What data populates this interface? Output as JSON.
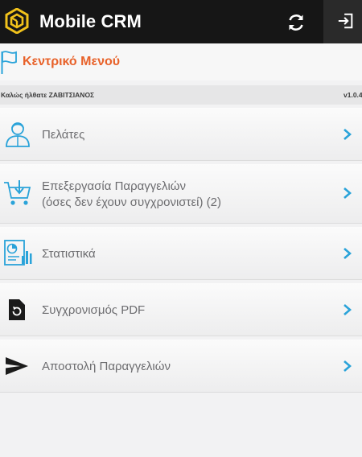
{
  "app": {
    "title": "Mobile CRM",
    "accent": "#e8622a",
    "icon_color": "#2aa3d9"
  },
  "header": {
    "menu_title": "Κεντρικό Μενού"
  },
  "welcome": {
    "text": "Καλώς ήλθατε ΖΑΒΙΤΣΙΑΝΟΣ",
    "version": "v1.0.4"
  },
  "menu": {
    "items": [
      {
        "label": "Πελάτες",
        "icon": "customer-icon"
      },
      {
        "label_line1": "Επεξεργασία Παραγγελιών",
        "label_line2": "(όσες δεν έχουν συγχρονιστεί) (2)",
        "icon": "cart-download-icon"
      },
      {
        "label": "Στατιστικά",
        "icon": "statistics-icon"
      },
      {
        "label": "Συγχρονισμός PDF",
        "icon": "pdf-sync-icon"
      },
      {
        "label": "Αποστολή Παραγγελιών",
        "icon": "send-icon"
      }
    ]
  }
}
